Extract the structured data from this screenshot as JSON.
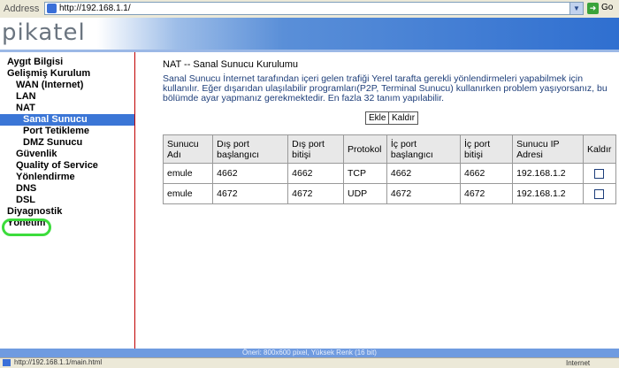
{
  "browser": {
    "address_label": "Address",
    "url": "http://192.168.1.1/",
    "go_label": "Go",
    "status_text": "http://192.168.1.1/main.html",
    "zone_text": "Internet"
  },
  "header": {
    "logo": "pikatel"
  },
  "sidebar": {
    "items": [
      {
        "label": "Aygıt Bilgisi"
      },
      {
        "label": "Gelişmiş Kurulum"
      },
      {
        "label": "WAN (Internet)"
      },
      {
        "label": "LAN"
      },
      {
        "label": "NAT"
      },
      {
        "label": "Sanal Sunucu"
      },
      {
        "label": "Port Tetikleme"
      },
      {
        "label": "DMZ Sunucu"
      },
      {
        "label": "Güvenlik"
      },
      {
        "label": "Quality of Service"
      },
      {
        "label": "Yönlendirme"
      },
      {
        "label": "DNS"
      },
      {
        "label": "DSL"
      },
      {
        "label": "Diyagnostik"
      },
      {
        "label": "Yönetim"
      }
    ]
  },
  "main": {
    "title": "NAT -- Sanal Sunucu Kurulumu",
    "description": "Sanal Sunucu İnternet tarafından içeri gelen trafiği Yerel tarafta gerekli yönlendirmeleri yapabilmek için kullanılır. Eğer dışarıdan ulaşılabilir programları(P2P, Terminal Sunucu) kullanırken problem yaşıyorsanız, bu bölümde ayar yapmanız gerekmektedir. En fazla 32 tanım yapılabilir.",
    "add_label": "Ekle",
    "remove_label": "Kaldır",
    "columns": {
      "c0": "Sunucu Adı",
      "c1": "Dış port başlangıcı",
      "c2": "Dış port bitişi",
      "c3": "Protokol",
      "c4": "İç port başlangıcı",
      "c5": "İç port bitişi",
      "c6": "Sunucu IP Adresi",
      "c7": "Kaldır"
    },
    "rows": [
      {
        "name": "emule",
        "ext_start": "4662",
        "ext_end": "4662",
        "proto": "TCP",
        "int_start": "4662",
        "int_end": "4662",
        "ip": "192.168.1.2"
      },
      {
        "name": "emule",
        "ext_start": "4672",
        "ext_end": "4672",
        "proto": "UDP",
        "int_start": "4672",
        "int_end": "4672",
        "ip": "192.168.1.2"
      }
    ]
  },
  "footer": {
    "text": "Öneri: 800x600 pixel, Yüksek Renk (16 bit)"
  }
}
